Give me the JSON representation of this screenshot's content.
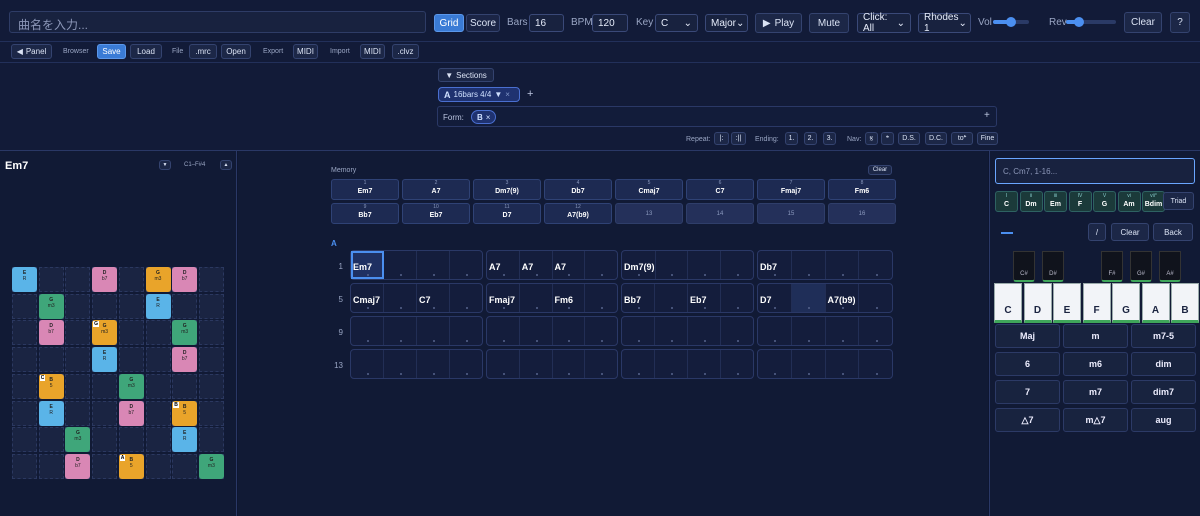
{
  "header": {
    "title_placeholder": "曲名を入力...",
    "view_grid": "Grid",
    "view_score": "Score",
    "bars_label": "Bars",
    "bars_value": "16",
    "bpm_label": "BPM",
    "bpm_value": "120",
    "key_label": "Key",
    "key_value": "C",
    "mode_value": "Major",
    "play": "Play",
    "mute": "Mute",
    "click_value": "Click: All",
    "instrument_value": "Rhodes 1",
    "vol_label": "Vol",
    "vol_level": 0.5,
    "rev_label": "Rev",
    "rev_level": 0.25,
    "clear": "Clear",
    "help": "?"
  },
  "toolbar": {
    "panel": "Panel",
    "browser_label": "Browser",
    "save": "Save",
    "load": "Load",
    "file_label": "File",
    "mrc": ".mrc",
    "open": "Open",
    "export_label": "Export",
    "export_midi": "MIDI",
    "import_label": "Import",
    "import_midi": "MIDI",
    "clvz": ".clvz"
  },
  "sections": {
    "toggle": "Sections",
    "chip_name": "A",
    "chip_text": "16bars  4/4",
    "chip_caret": "▼",
    "add": "+",
    "form_label": "Form:",
    "form_chip": "B",
    "form_add": "+",
    "repeat_label": "Repeat:",
    "repeat_open": "|:",
    "repeat_close": ":||",
    "ending_label": "Ending:",
    "ending1": "1.",
    "ending2": "2.",
    "ending3": "3.",
    "nav_label": "Nav:",
    "nav_segno": "𝄋",
    "nav_coda": "𝄌",
    "nav_ds": "D.S.",
    "nav_dc": "D.C.",
    "nav_toc": "to𝄌",
    "nav_fine": "Fine"
  },
  "left": {
    "chord": "Em7",
    "range": "C1–F#4",
    "down": "▼",
    "up": "▲"
  },
  "memory": {
    "label": "Memory",
    "clear": "Clear",
    "slots": [
      {
        "n": "1",
        "c": "Em7"
      },
      {
        "n": "2",
        "c": "A7"
      },
      {
        "n": "3",
        "c": "Dm7(9)"
      },
      {
        "n": "4",
        "c": "Db7"
      },
      {
        "n": "5",
        "c": "Cmaj7"
      },
      {
        "n": "6",
        "c": "C7"
      },
      {
        "n": "7",
        "c": "Fmaj7"
      },
      {
        "n": "8",
        "c": "Fm6"
      },
      {
        "n": "9",
        "c": "Bb7"
      },
      {
        "n": "10",
        "c": "Eb7"
      },
      {
        "n": "11",
        "c": "D7"
      },
      {
        "n": "12",
        "c": "A7(b9)"
      },
      {
        "n": "13",
        "c": ""
      },
      {
        "n": "14",
        "c": ""
      },
      {
        "n": "15",
        "c": ""
      },
      {
        "n": "16",
        "c": ""
      }
    ]
  },
  "grid": {
    "section": "A",
    "rows": [
      {
        "no": "1",
        "measures": [
          [
            "Em7",
            "",
            "",
            ""
          ],
          [
            "A7",
            "A7",
            "A7",
            ""
          ],
          [
            "Dm7(9)",
            "",
            "",
            ""
          ],
          [
            "Db7",
            "",
            "",
            ""
          ]
        ]
      },
      {
        "no": "5",
        "measures": [
          [
            "Cmaj7",
            "",
            "C7",
            ""
          ],
          [
            "Fmaj7",
            "",
            "Fm6",
            ""
          ],
          [
            "Bb7",
            "",
            "Eb7",
            ""
          ],
          [
            "D7",
            "",
            "A7(b9)",
            ""
          ]
        ]
      },
      {
        "no": "9",
        "measures": [
          [
            "",
            "",
            "",
            ""
          ],
          [
            "",
            "",
            "",
            ""
          ],
          [
            "",
            "",
            "",
            ""
          ],
          [
            "",
            "",
            "",
            ""
          ]
        ]
      },
      {
        "no": "13",
        "measures": [
          [
            "",
            "",
            "",
            ""
          ],
          [
            "",
            "",
            "",
            ""
          ],
          [
            "",
            "",
            "",
            ""
          ],
          [
            "",
            "",
            "",
            ""
          ]
        ]
      }
    ]
  },
  "right": {
    "input_placeholder": "C, Cm7, 1-16...",
    "diatonic": [
      {
        "r": "I",
        "c": "C"
      },
      {
        "r": "ii",
        "c": "Dm"
      },
      {
        "r": "iii",
        "c": "Em"
      },
      {
        "r": "IV",
        "c": "F"
      },
      {
        "r": "V",
        "c": "G"
      },
      {
        "r": "vi",
        "c": "Am"
      },
      {
        "r": "vii°",
        "c": "Bdim"
      }
    ],
    "triad": "Triad",
    "slash": "/",
    "clear": "Clear",
    "back": "Back",
    "white_keys": [
      "C",
      "D",
      "E",
      "F",
      "G",
      "A",
      "B"
    ],
    "black_keys": [
      "C#",
      "D#",
      "F#",
      "G#",
      "A#"
    ],
    "qualities": [
      "Maj",
      "m",
      "m7-5",
      "6",
      "m6",
      "dim",
      "7",
      "m7",
      "dim7",
      "△7",
      "m△7",
      "aug"
    ]
  },
  "fretboard": {
    "tiles": [
      {
        "r": 0,
        "c": 0,
        "col": "#5ab4e8",
        "t": "E",
        "s": "R"
      },
      {
        "r": 0,
        "c": 3,
        "col": "#d987b5",
        "t": "D",
        "s": "b7"
      },
      {
        "r": 0,
        "c": 5,
        "col": "#e9a42a",
        "t": "G",
        "s": "m3"
      },
      {
        "r": 0,
        "c": 6,
        "col": "#d987b5",
        "t": "D",
        "s": "b7"
      },
      {
        "r": 1,
        "c": 1,
        "col": "#3fa67a",
        "t": "G",
        "s": "m3"
      },
      {
        "r": 1,
        "c": 5,
        "col": "#5ab4e8",
        "t": "E",
        "s": "R"
      },
      {
        "r": 2,
        "c": 1,
        "col": "#d987b5",
        "t": "D",
        "s": "b7"
      },
      {
        "r": 2,
        "c": 3,
        "col": "#e9a42a",
        "t": "G",
        "s": "m3",
        "tag": "G"
      },
      {
        "r": 2,
        "c": 6,
        "col": "#3fa67a",
        "t": "G",
        "s": "m3"
      },
      {
        "r": 3,
        "c": 3,
        "col": "#5ab4e8",
        "t": "E",
        "s": "R"
      },
      {
        "r": 3,
        "c": 6,
        "col": "#d987b5",
        "t": "D",
        "s": "b7"
      },
      {
        "r": 4,
        "c": 1,
        "col": "#e9a42a",
        "t": "B",
        "s": "5",
        "tag": "C"
      },
      {
        "r": 4,
        "c": 4,
        "col": "#3fa67a",
        "t": "G",
        "s": "m3"
      },
      {
        "r": 5,
        "c": 1,
        "col": "#5ab4e8",
        "t": "E",
        "s": "R"
      },
      {
        "r": 5,
        "c": 4,
        "col": "#d987b5",
        "t": "D",
        "s": "b7"
      },
      {
        "r": 5,
        "c": 6,
        "col": "#e9a42a",
        "t": "B",
        "s": "5",
        "tag": "B"
      },
      {
        "r": 6,
        "c": 2,
        "col": "#3fa67a",
        "t": "G",
        "s": "m3"
      },
      {
        "r": 6,
        "c": 6,
        "col": "#5ab4e8",
        "t": "E",
        "s": "R"
      },
      {
        "r": 7,
        "c": 2,
        "col": "#d987b5",
        "t": "D",
        "s": "b7"
      },
      {
        "r": 7,
        "c": 4,
        "col": "#e9a42a",
        "t": "B",
        "s": "5",
        "tag": "A"
      },
      {
        "r": 7,
        "c": 7,
        "col": "#3fa67a",
        "t": "G",
        "s": "m3"
      }
    ]
  }
}
